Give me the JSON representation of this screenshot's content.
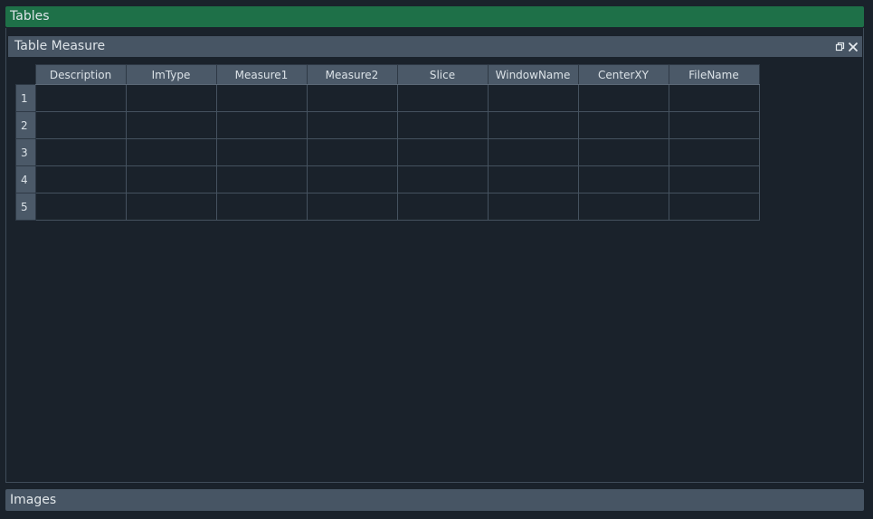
{
  "tables_header": {
    "label": "Tables"
  },
  "dock": {
    "title": "Table Measure",
    "float_icon": "restore-window-icon",
    "close_icon": "close-icon"
  },
  "table": {
    "columns": [
      "Description",
      "ImType",
      "Measure1",
      "Measure2",
      "Slice",
      "WindowName",
      "CenterXY",
      "FileName"
    ],
    "rows": [
      "1",
      "2",
      "3",
      "4",
      "5"
    ]
  },
  "images_bar": {
    "label": "Images"
  },
  "colors": {
    "accent": "#1e7048",
    "panel": "#475564",
    "background": "#1a222b"
  }
}
